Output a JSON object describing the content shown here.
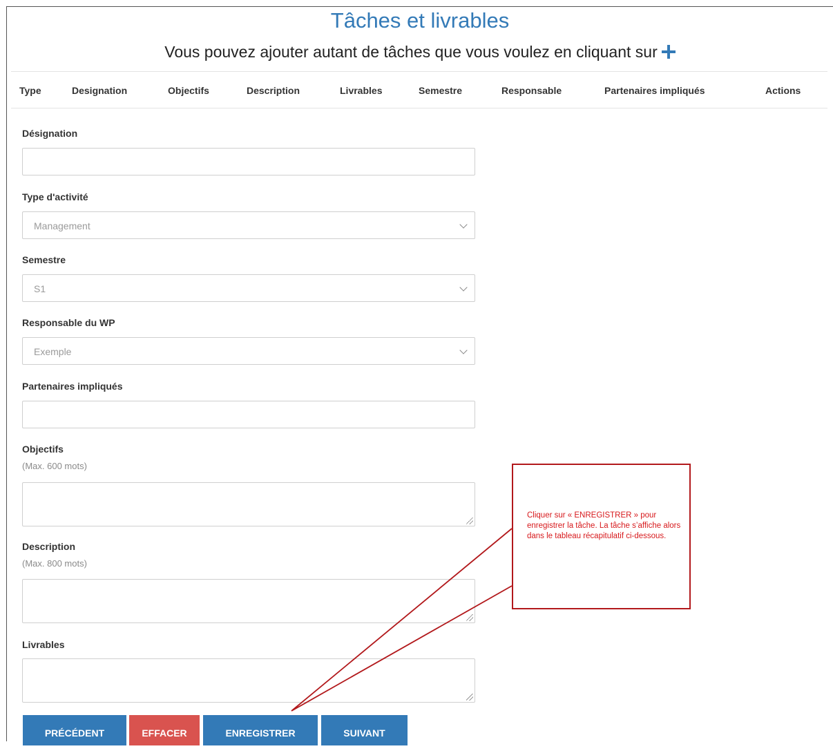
{
  "page": {
    "title": "Tâches et livrables",
    "subtitle": "Vous pouvez ajouter autant de tâches que vous voulez en cliquant sur",
    "add_icon": "plus-icon",
    "accent_color": "#337ab7"
  },
  "table": {
    "columns": [
      "Type",
      "Designation",
      "Objectifs",
      "Description",
      "Livrables",
      "Semestre",
      "Responsable",
      "Partenaires impliqués",
      "Actions"
    ]
  },
  "form": {
    "designation": {
      "label": "Désignation",
      "value": ""
    },
    "type_activite": {
      "label": "Type d'activité",
      "selected": "Management"
    },
    "semestre": {
      "label": "Semestre",
      "selected": "S1"
    },
    "responsable": {
      "label": "Responsable du WP",
      "selected": "Exemple"
    },
    "partenaires": {
      "label": "Partenaires impliqués",
      "value": ""
    },
    "objectifs": {
      "label": "Objectifs",
      "hint": "(Max. 600 mots)",
      "value": ""
    },
    "description": {
      "label": "Description",
      "hint": "(Max. 800 mots)",
      "value": ""
    },
    "livrables": {
      "label": "Livrables",
      "value": ""
    }
  },
  "buttons": {
    "previous": "PRÉCÉDENT",
    "clear": "EFFACER",
    "save": "ENREGISTRER",
    "next": "SUIVANT",
    "blue_color": "#337ab7",
    "red_color": "#d9534f"
  },
  "annotation": {
    "text": "Cliquer sur « ENREGISTRER » pour enregistrer la tâche. La tâche s’affiche alors dans le tableau récapitulatif ci-dessous.",
    "border_color": "#b2181b",
    "text_color": "#d7191c"
  }
}
